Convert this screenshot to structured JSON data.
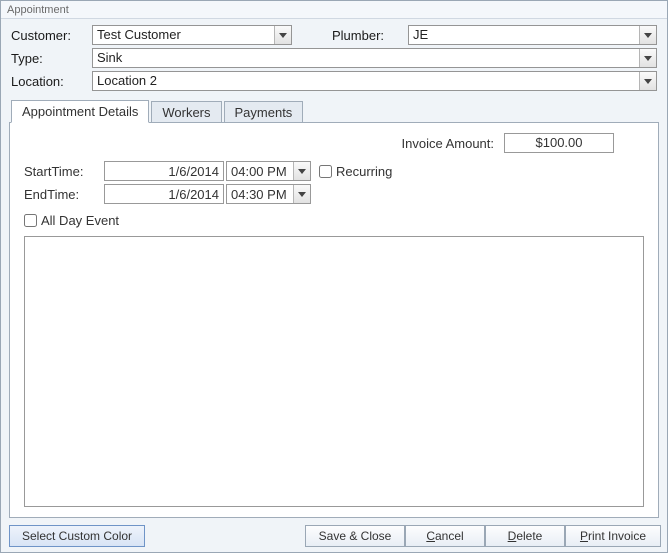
{
  "title": "Appointment",
  "header": {
    "customer_label": "Customer:",
    "customer_value": "Test Customer",
    "plumber_label": "Plumber:",
    "plumber_value": "JE",
    "type_label": "Type:",
    "type_value": "Sink",
    "location_label": "Location:",
    "location_value": "Location 2"
  },
  "tabs": {
    "details": "Appointment Details",
    "workers": "Workers",
    "payments": "Payments"
  },
  "details": {
    "invoice_label": "Invoice Amount:",
    "invoice_value": "$100.00",
    "start_label": "StartTime:",
    "start_date": "1/6/2014",
    "start_time": "04:00 PM",
    "recurring_label": "Recurring",
    "recurring_checked": false,
    "end_label": "EndTime:",
    "end_date": "1/6/2014",
    "end_time": "04:30 PM",
    "allday_label": "All Day Event",
    "allday_checked": false,
    "notes": ""
  },
  "buttons": {
    "color": "Select Custom Color",
    "save": "Save & Close",
    "cancel": "Cancel",
    "delete": "Delete",
    "print": "Print Invoice"
  }
}
